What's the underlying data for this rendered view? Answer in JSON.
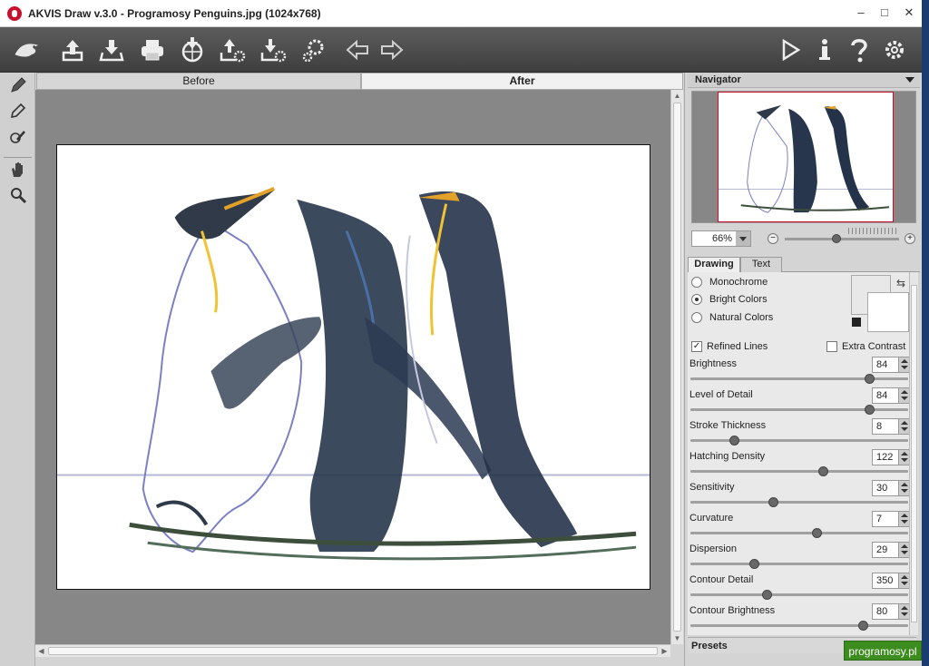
{
  "window": {
    "title": "AKVIS Draw v.3.0 - Programosy Penguins.jpg (1024x768)"
  },
  "window_controls": {
    "minimize": "–",
    "maximize": "□",
    "close": "✕"
  },
  "toolbar": {
    "items": [
      {
        "name": "akvis-logo-icon"
      },
      {
        "name": "open-image-icon"
      },
      {
        "name": "save-image-icon"
      },
      {
        "name": "print-icon"
      },
      {
        "name": "publish-icon"
      },
      {
        "name": "load-settings-icon"
      },
      {
        "name": "save-settings-icon"
      },
      {
        "name": "preferences-gear-icon"
      },
      {
        "name": "undo-arrow-icon"
      },
      {
        "name": "redo-arrow-icon"
      },
      {
        "name": "run-icon"
      },
      {
        "name": "info-icon"
      },
      {
        "name": "help-icon"
      },
      {
        "name": "settings-gear-icon"
      }
    ]
  },
  "left_tools": [
    "pencil-tool-icon",
    "eraser-tool-icon",
    "history-brush-icon",
    "hand-tool-icon",
    "zoom-tool-icon"
  ],
  "view_tabs": {
    "before": "Before",
    "after": "After"
  },
  "navigator": {
    "title": "Navigator",
    "zoom_value": "66%",
    "zoom_level": 0.45
  },
  "panel_tabs": {
    "drawing": "Drawing",
    "text": "Text"
  },
  "drawing": {
    "modes": [
      {
        "label": "Monochrome",
        "selected": false
      },
      {
        "label": "Bright Colors",
        "selected": true
      },
      {
        "label": "Natural Colors",
        "selected": false
      }
    ],
    "refined_lines": {
      "label": "Refined Lines",
      "checked": true,
      "mark": "✓"
    },
    "extra_contrast": {
      "label": "Extra Contrast",
      "checked": false,
      "mark": ""
    },
    "parameters": [
      {
        "label": "Brightness",
        "value": "84",
        "level": 0.82
      },
      {
        "label": "Level of Detail",
        "value": "84",
        "level": 0.82
      },
      {
        "label": "Stroke Thickness",
        "value": "8",
        "level": 0.2
      },
      {
        "label": "Hatching Density",
        "value": "122",
        "level": 0.61
      },
      {
        "label": "Sensitivity",
        "value": "30",
        "level": 0.38
      },
      {
        "label": "Curvature",
        "value": "7",
        "level": 0.58
      },
      {
        "label": "Dispersion",
        "value": "29",
        "level": 0.29
      },
      {
        "label": "Contour Detail",
        "value": "350",
        "level": 0.35
      },
      {
        "label": "Contour Brightness",
        "value": "80",
        "level": 0.79
      }
    ]
  },
  "presets": {
    "title": "Presets"
  },
  "watermark": "programosy.pl",
  "colors": {
    "toolbar": "#4a4a4a",
    "accent": "#c8102e",
    "canvas": "#878787"
  }
}
